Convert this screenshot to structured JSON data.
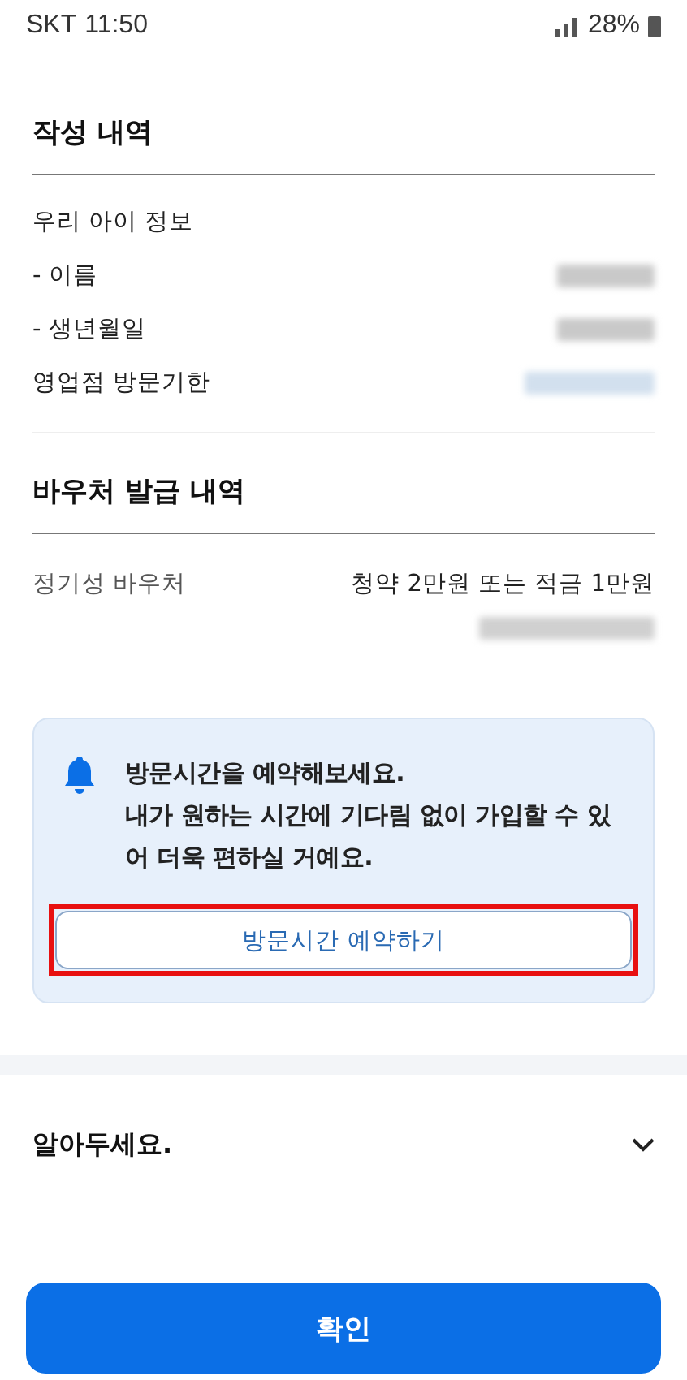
{
  "status_bar": {
    "carrier": "SKT",
    "time": "11:50",
    "battery": "28%"
  },
  "written_section": {
    "title": "작성 내역",
    "rows": [
      {
        "kind": "heading",
        "label": "우리 아이 정보"
      },
      {
        "kind": "sub",
        "label": "- 이름"
      },
      {
        "kind": "sub",
        "label": "- 생년월일"
      },
      {
        "kind": "date",
        "label": "영업점 방문기한"
      }
    ]
  },
  "voucher_section": {
    "title": "바우처 발급 내역",
    "label": "정기성 바우처",
    "value": "청약 2만원 또는 적금 1만원"
  },
  "notice": {
    "lines": [
      "방문시간을 예약해보세요.",
      "내가 원하는 시간에 기다림 없이 가입할 수 있어 더욱 편하실 거예요."
    ],
    "button": {
      "label": "방문시간 예약하기",
      "highlighted": true
    }
  },
  "accordion": {
    "title": "알아두세요.",
    "expanded": false
  },
  "confirm_button": "확인"
}
